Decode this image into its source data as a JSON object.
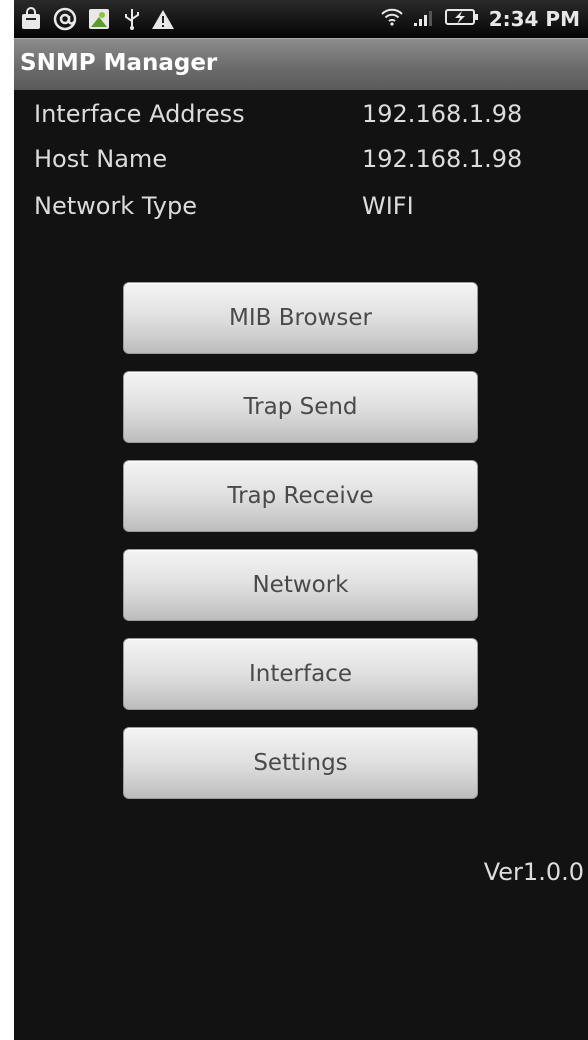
{
  "status_bar": {
    "time": "2:34 PM",
    "left_icons": [
      "shopping-bag-icon",
      "at-icon",
      "android-icon",
      "usb-icon",
      "warning-icon"
    ],
    "right_icons": [
      "wifi-icon",
      "signal-icon",
      "battery-charging-icon"
    ]
  },
  "app": {
    "title": "SNMP Manager"
  },
  "info": [
    {
      "label": "Interface Address",
      "value": "192.168.1.98"
    },
    {
      "label": "Host Name",
      "value": "192.168.1.98"
    },
    {
      "label": "Network Type",
      "value": "WIFI"
    }
  ],
  "buttons": [
    {
      "label": "MIB Browser"
    },
    {
      "label": "Trap Send"
    },
    {
      "label": "Trap Receive"
    },
    {
      "label": "Network"
    },
    {
      "label": "Interface"
    },
    {
      "label": "Settings"
    }
  ],
  "version": "Ver1.0.0",
  "colors": {
    "background": "#121212",
    "title_bar": "#737373",
    "button_face": "#dedede",
    "button_text": "#4a4a4a",
    "text": "#dcdcdc"
  }
}
